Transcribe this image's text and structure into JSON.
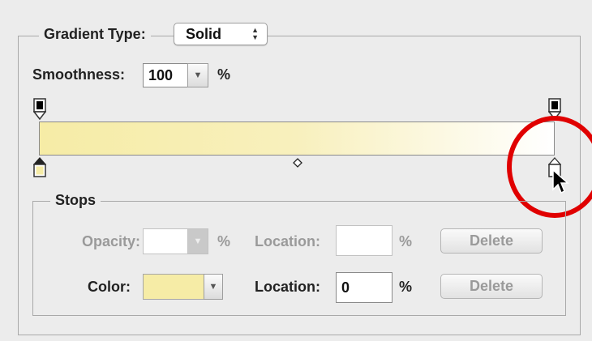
{
  "gradient_type": {
    "label": "Gradient Type:",
    "value": "Solid"
  },
  "smoothness": {
    "label": "Smoothness:",
    "value": "100",
    "unit": "%"
  },
  "gradient": {
    "start_color": "#f6eca6",
    "end_color": "#ffffff",
    "opacity_stop_color": "#000000",
    "highlight_circle_color": "#e00000"
  },
  "stops": {
    "legend": "Stops",
    "opacity_label": "Opacity:",
    "opacity_value": "",
    "opacity_unit": "%",
    "opacity_location_label": "Location:",
    "opacity_location_value": "",
    "opacity_location_unit": "%",
    "opacity_delete_label": "Delete",
    "color_label": "Color:",
    "color_swatch": "#f6eca6",
    "color_location_label": "Location:",
    "color_location_value": "0",
    "color_location_unit": "%",
    "color_delete_label": "Delete"
  }
}
